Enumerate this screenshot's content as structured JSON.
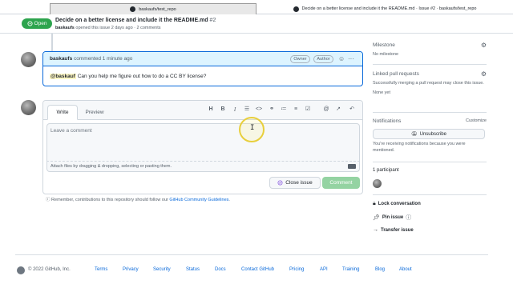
{
  "browser": {
    "active_tab": "baskaufs/test_repo",
    "inactive_tab": "Decide on a better license and include it the README.md · Issue #2 · baskaufs/test_repo"
  },
  "header": {
    "status": "Open",
    "title": "Decide on a better license and include it the README.md",
    "number": "#2",
    "author": "baskaufs",
    "meta": "opened this issue 2 days ago · 2 comments"
  },
  "comment": {
    "author": "baskaufs",
    "time": "commented 1 minute ago",
    "badges": [
      "Owner",
      "Author"
    ],
    "mention": "@baskauf",
    "body": " Can you help me figure out how to do a CC BY license?"
  },
  "editor": {
    "tabs": [
      "Write",
      "Preview"
    ],
    "toolbar_icons": [
      "heading-icon",
      "bold-icon",
      "italic-icon",
      "quote-icon",
      "code-icon",
      "link-icon",
      "bulleted-list-icon",
      "numbered-list-icon",
      "task-list-icon",
      "mention-icon",
      "reference-icon",
      "saved-reply-icon"
    ],
    "placeholder": "Leave a comment",
    "attach_hint": "Attach files by dragging & dropping, selecting or pasting them.",
    "close_label": "Close issue",
    "comment_label": "Comment",
    "reminder_prefix": "Remember, contributions to this repository should follow our ",
    "reminder_link": "GitHub Community Guidelines",
    "reminder_suffix": "."
  },
  "sidebar": {
    "milestone_title": "Milestone",
    "milestone_value": "No milestone",
    "linked_title": "Linked pull requests",
    "linked_text": "Successfully merging a pull request may close this issue.",
    "linked_value": "None yet",
    "notifications_title": "Notifications",
    "customize": "Customize",
    "unsubscribe": "Unsubscribe",
    "notifications_text": "You're receiving notifications because you were mentioned.",
    "participants": "1 participant",
    "lock": "Lock conversation",
    "pin": "Pin issue",
    "transfer": "Transfer issue"
  },
  "footer": {
    "copyright": "© 2022 GitHub, Inc.",
    "links": [
      "Terms",
      "Privacy",
      "Security",
      "Status",
      "Docs",
      "Contact GitHub",
      "Pricing",
      "API",
      "Training",
      "Blog",
      "About"
    ]
  },
  "colors": {
    "open_green": "#2da44e",
    "accent_blue": "#0969da",
    "comment_disabled": "#94d3a2"
  }
}
